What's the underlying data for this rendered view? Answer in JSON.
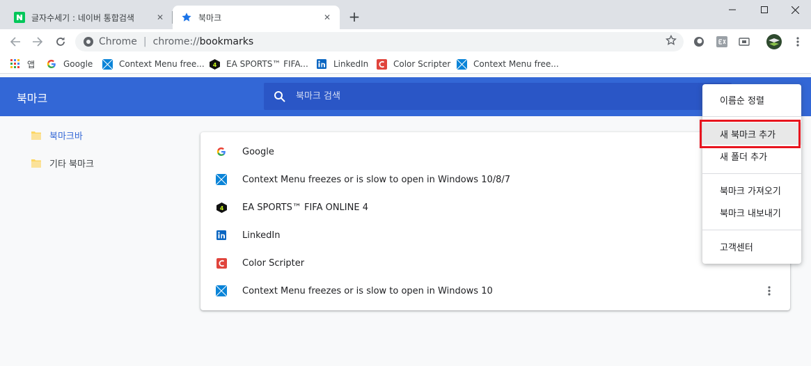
{
  "browser": {
    "tabs": [
      {
        "title": "글자수세기 : 네이버 통합검색",
        "favicon": "naver-icon",
        "close_label": "✕"
      },
      {
        "title": "북마크",
        "favicon": "star-icon",
        "close_label": "✕"
      }
    ],
    "new_tab_label": "+",
    "window_controls": {
      "minimize": "—",
      "maximize": "☐",
      "close": "✕"
    },
    "omnibox": {
      "chip": "Chrome",
      "separator": "|",
      "url_scheme": "chrome://",
      "url_host": "bookmarks"
    }
  },
  "bookmarks_bar": [
    {
      "label": "앱",
      "icon": "apps-grid-icon"
    },
    {
      "label": "Google",
      "icon": "google-icon"
    },
    {
      "label": "Context Menu free...",
      "icon": "windows-icon"
    },
    {
      "label": "EA SPORTS™ FIFA...",
      "icon": "fifa-icon"
    },
    {
      "label": "LinkedIn",
      "icon": "linkedin-icon"
    },
    {
      "label": "Color Scripter",
      "icon": "color-scripter-icon"
    },
    {
      "label": "Context Menu free...",
      "icon": "windows-icon"
    }
  ],
  "page": {
    "title": "북마크",
    "search_placeholder": "북마크 검색"
  },
  "sidebar": {
    "items": [
      {
        "label": "북마크바",
        "selected": true
      },
      {
        "label": "기타 북마크",
        "selected": false
      }
    ]
  },
  "bookmarks": [
    {
      "title": "Google",
      "icon": "google-icon"
    },
    {
      "title": "Context Menu freezes or is slow to open in Windows 10/8/7",
      "icon": "windows-icon"
    },
    {
      "title": "EA SPORTS™ FIFA ONLINE 4",
      "icon": "fifa-icon"
    },
    {
      "title": "LinkedIn",
      "icon": "linkedin-icon"
    },
    {
      "title": "Color Scripter",
      "icon": "color-scripter-icon"
    },
    {
      "title": "Context Menu freezes or is slow to open in Windows 10",
      "icon": "windows-icon"
    }
  ],
  "menu": {
    "items": [
      {
        "label": "이름순 정렬"
      },
      {
        "label": "새 북마크 추가",
        "highlighted": true
      },
      {
        "label": "새 폴더 추가"
      },
      {
        "label": "북마크 가져오기"
      },
      {
        "label": "북마크 내보내기"
      },
      {
        "label": "고객센터"
      }
    ]
  },
  "colors": {
    "header_blue": "#3367d6",
    "search_blue": "#2a56c6",
    "highlight_box": "#e8141e",
    "folder_yellow": "#fdd663"
  }
}
